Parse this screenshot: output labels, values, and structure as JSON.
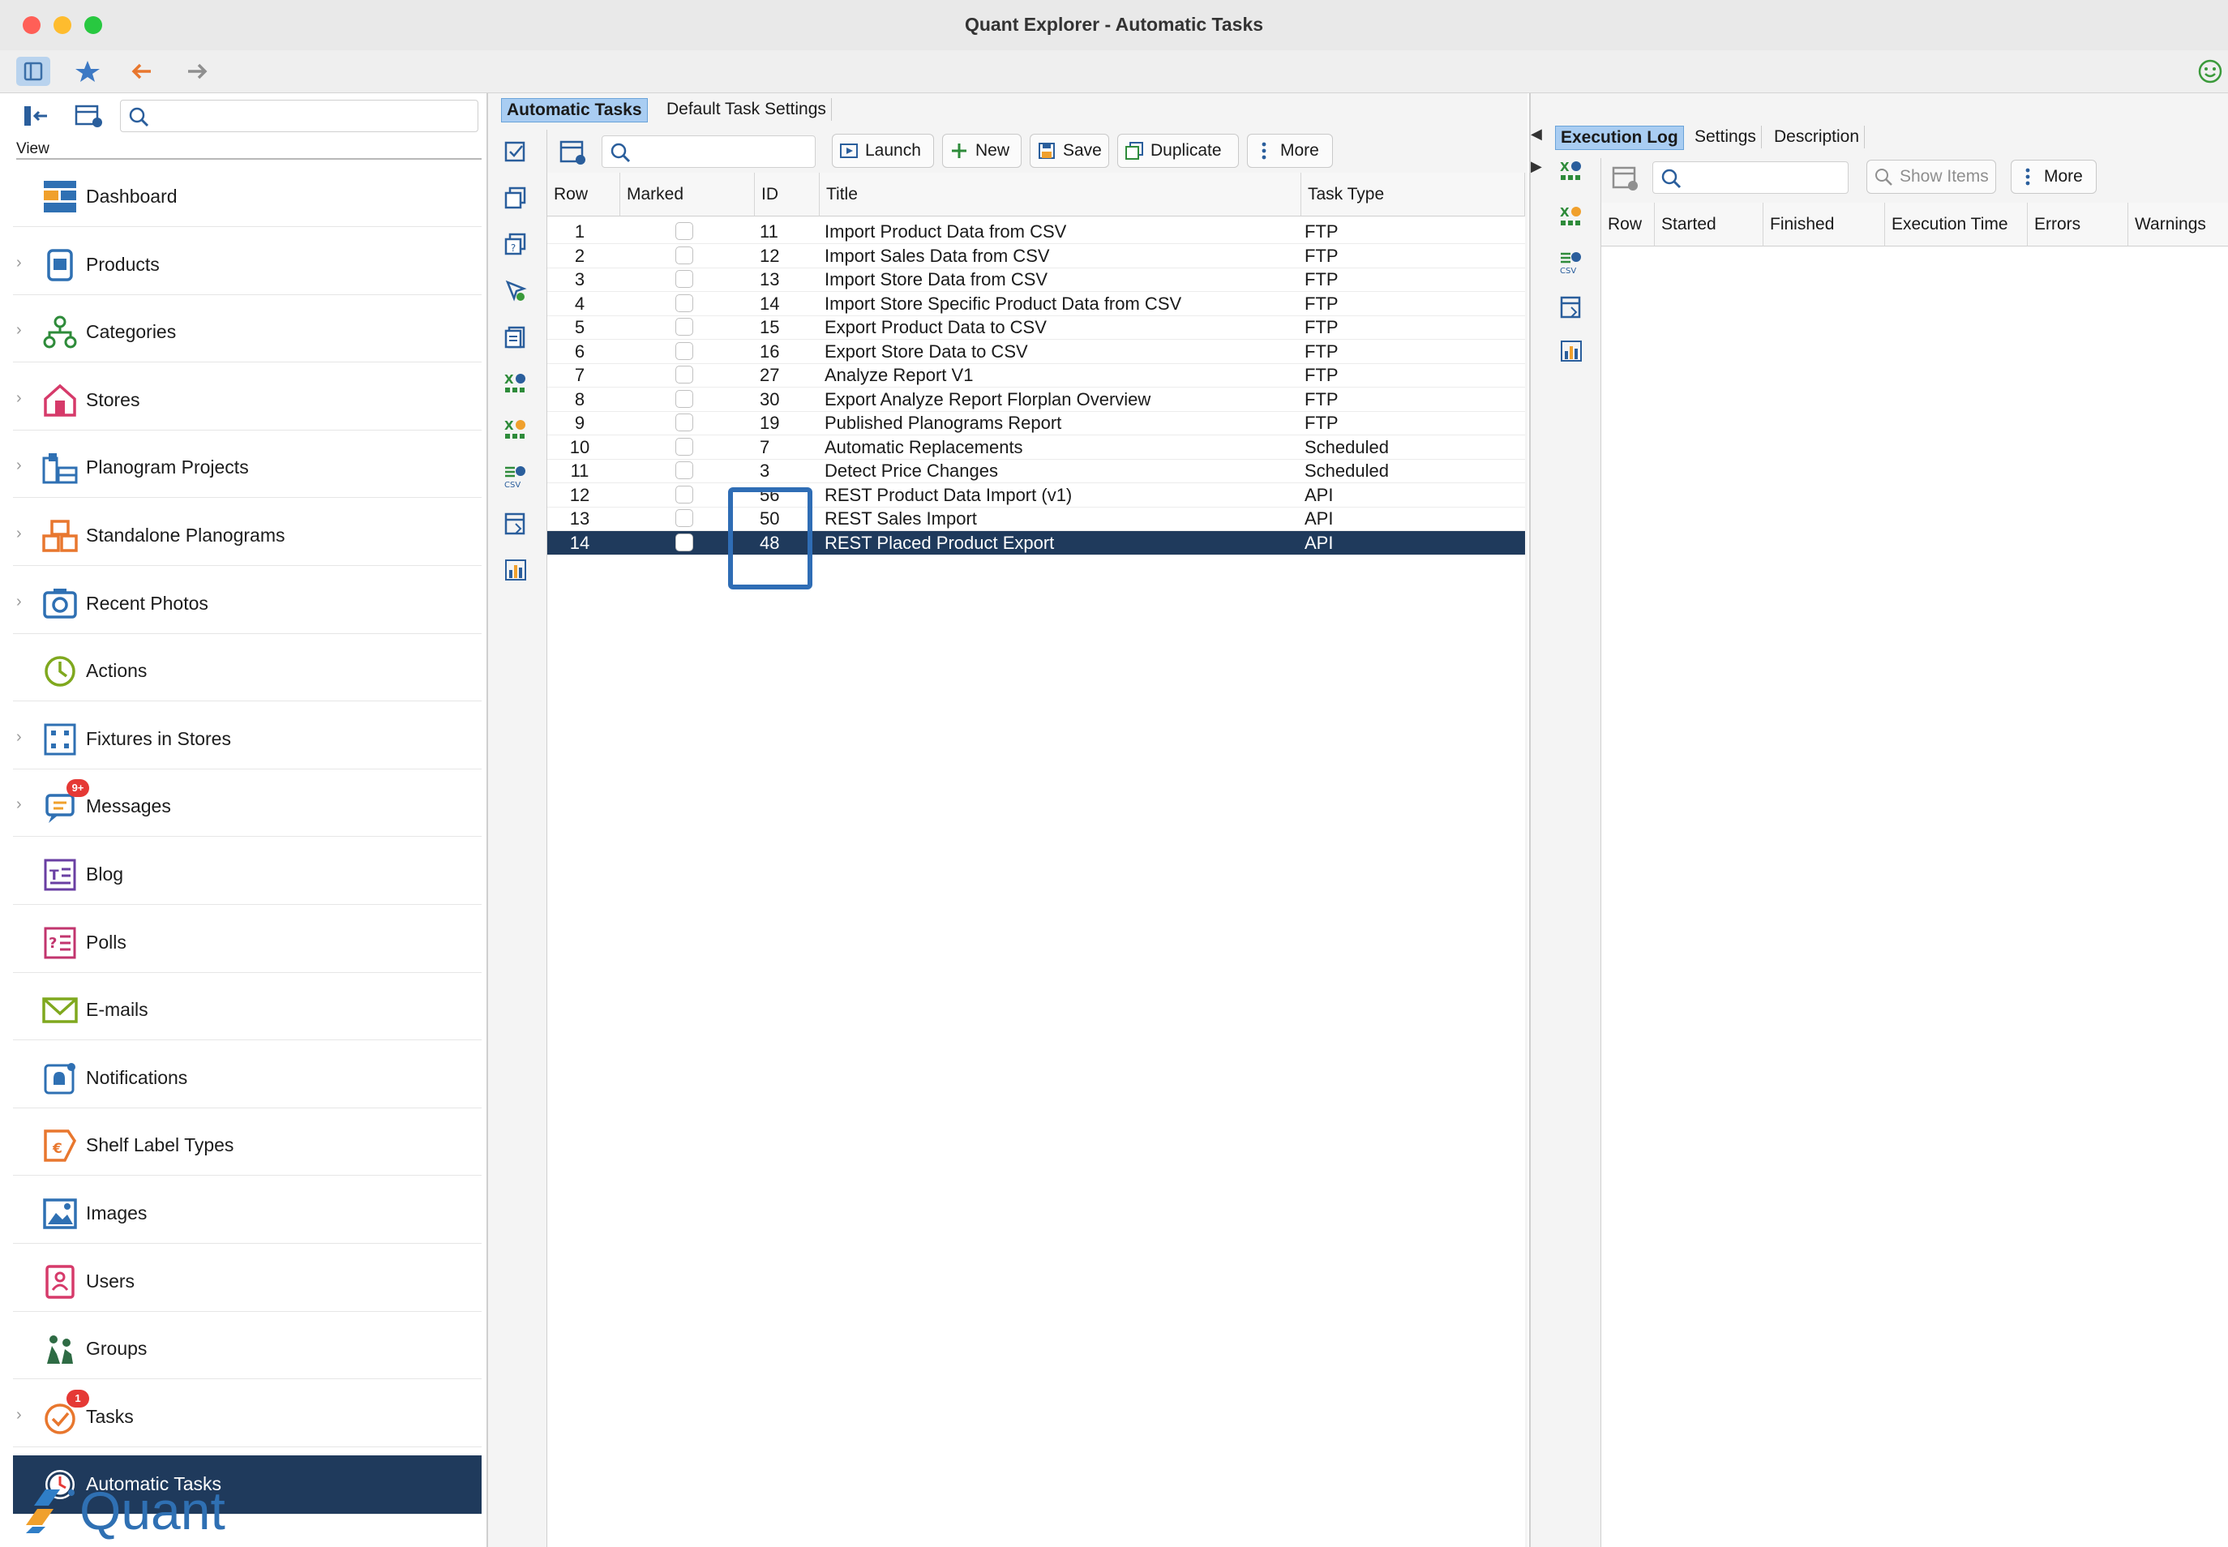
{
  "window": {
    "title": "Quant Explorer - Automatic Tasks"
  },
  "toolbar": {
    "icons": [
      "sidebar-icon",
      "star-icon",
      "back-arrow-icon",
      "forward-arrow-icon",
      "smiley-icon"
    ]
  },
  "left_panel": {
    "view_label": "View",
    "search_placeholder": "",
    "logo_text": "Quant",
    "items": [
      {
        "label": "Dashboard",
        "icon": "dashboard-icon",
        "expandable": false
      },
      {
        "label": "Products",
        "icon": "products-icon",
        "expandable": true
      },
      {
        "label": "Categories",
        "icon": "categories-icon",
        "expandable": true
      },
      {
        "label": "Stores",
        "icon": "stores-icon",
        "expandable": true
      },
      {
        "label": "Planogram Projects",
        "icon": "planogram-projects-icon",
        "expandable": true
      },
      {
        "label": "Standalone Planograms",
        "icon": "standalone-planograms-icon",
        "expandable": true
      },
      {
        "label": "Recent Photos",
        "icon": "camera-icon",
        "expandable": true
      },
      {
        "label": "Actions",
        "icon": "actions-icon",
        "expandable": false
      },
      {
        "label": "Fixtures in Stores",
        "icon": "fixtures-icon",
        "expandable": true
      },
      {
        "label": "Messages",
        "icon": "messages-icon",
        "expandable": true,
        "badge": "9+"
      },
      {
        "label": "Blog",
        "icon": "blog-icon",
        "expandable": false
      },
      {
        "label": "Polls",
        "icon": "polls-icon",
        "expandable": false
      },
      {
        "label": "E-mails",
        "icon": "email-icon",
        "expandable": false
      },
      {
        "label": "Notifications",
        "icon": "notifications-icon",
        "expandable": false
      },
      {
        "label": "Shelf Label Types",
        "icon": "shelf-label-icon",
        "expandable": false
      },
      {
        "label": "Images",
        "icon": "images-icon",
        "expandable": false
      },
      {
        "label": "Users",
        "icon": "users-icon",
        "expandable": false
      },
      {
        "label": "Groups",
        "icon": "groups-icon",
        "expandable": false
      },
      {
        "label": "Tasks",
        "icon": "tasks-icon",
        "expandable": true,
        "badge": "1"
      },
      {
        "label": "Automatic Tasks",
        "icon": "automatic-tasks-icon",
        "expandable": false,
        "selected": true
      }
    ]
  },
  "center": {
    "tabs": [
      "Automatic Tasks",
      "Default Task Settings"
    ],
    "buttons": {
      "launch": "Launch",
      "new": "New",
      "save": "Save",
      "duplicate": "Duplicate",
      "more": "More"
    },
    "columns": [
      "Row",
      "Marked",
      "ID",
      "Title",
      "Task Type"
    ],
    "rows": [
      {
        "row": "1",
        "id": "11",
        "title": "Import Product Data from CSV",
        "type": "FTP"
      },
      {
        "row": "2",
        "id": "12",
        "title": "Import Sales Data from CSV",
        "type": "FTP"
      },
      {
        "row": "3",
        "id": "13",
        "title": "Import Store Data from CSV",
        "type": "FTP"
      },
      {
        "row": "4",
        "id": "14",
        "title": "Import Store Specific Product Data from CSV",
        "type": "FTP"
      },
      {
        "row": "5",
        "id": "15",
        "title": "Export Product Data to CSV",
        "type": "FTP"
      },
      {
        "row": "6",
        "id": "16",
        "title": "Export Store Data to CSV",
        "type": "FTP"
      },
      {
        "row": "7",
        "id": "27",
        "title": "Analyze Report V1",
        "type": "FTP"
      },
      {
        "row": "8",
        "id": "30",
        "title": "Export Analyze Report Florplan Overview",
        "type": "FTP"
      },
      {
        "row": "9",
        "id": "19",
        "title": "Published Planograms Report",
        "type": "FTP"
      },
      {
        "row": "10",
        "id": "7",
        "title": "Automatic Replacements",
        "type": "Scheduled"
      },
      {
        "row": "11",
        "id": "3",
        "title": "Detect Price Changes",
        "type": "Scheduled"
      },
      {
        "row": "12",
        "id": "56",
        "title": "REST Product Data Import (v1)",
        "type": "API"
      },
      {
        "row": "13",
        "id": "50",
        "title": "REST Sales Import",
        "type": "API"
      },
      {
        "row": "14",
        "id": "48",
        "title": "REST Placed Product Export",
        "type": "API",
        "selected": true
      }
    ]
  },
  "right": {
    "tabs": [
      "Execution Log",
      "Settings",
      "Description"
    ],
    "buttons": {
      "show_items": "Show Items",
      "more": "More"
    },
    "columns": [
      "Row",
      "Started",
      "Finished",
      "Execution Time",
      "Errors",
      "Warnings"
    ]
  },
  "colors": {
    "selection": "#1f3a5c",
    "tab_active": "#a9cdf2",
    "highlight_box": "#2f6db5",
    "badge": "#e53935"
  }
}
